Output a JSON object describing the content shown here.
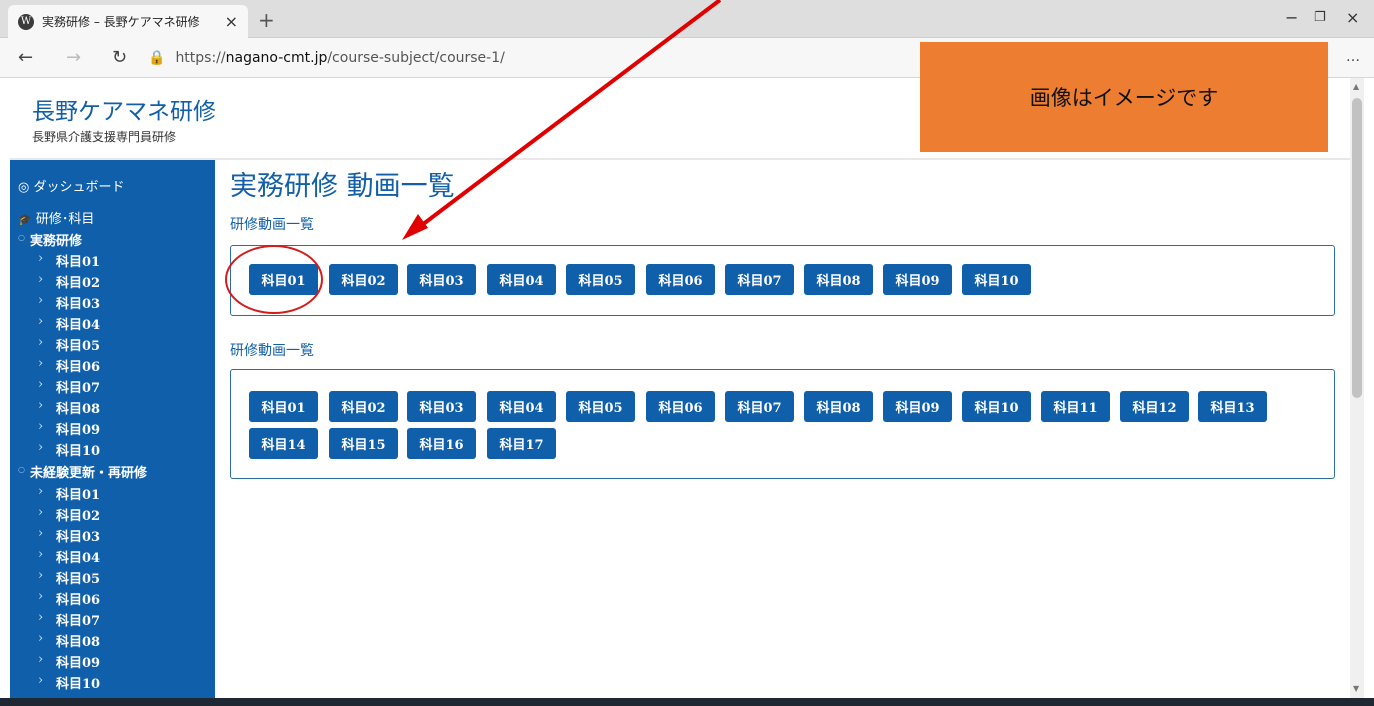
{
  "browser": {
    "tab_title": "実務研修 – 長野ケアマネ研修",
    "tab_favicon": "W",
    "url_prefix": "https://",
    "url_host": "nagano-cmt.jp",
    "url_path": "/course-subject/course-1/",
    "close_tab_glyph": "×",
    "new_tab_glyph": "+",
    "minimize_glyph": "−",
    "restore_glyph": "❐",
    "close_window_glyph": "×",
    "back_glyph": "←",
    "forward_glyph": "→",
    "refresh_glyph": "↻",
    "lock_glyph": "🔒",
    "more_glyph": "…"
  },
  "site": {
    "brand": "長野ケアマネ研修",
    "subtitle": "長野県介護支援専門員研修"
  },
  "sidebar": {
    "dashboard": "ダッシュボード",
    "dashboard_icon": "◎",
    "courses": "研修･科目",
    "courses_icon": "🎓",
    "bullet_glyph": "○",
    "chevron_glyph": "›",
    "group1": {
      "label": "実務研修",
      "items": [
        "科目01",
        "科目02",
        "科目03",
        "科目04",
        "科目05",
        "科目06",
        "科目07",
        "科目08",
        "科目09",
        "科目10"
      ]
    },
    "group2": {
      "label": "未経験更新・再研修",
      "items": [
        "科目01",
        "科目02",
        "科目03",
        "科目04",
        "科目05",
        "科目06",
        "科目07",
        "科目08",
        "科目09",
        "科目10"
      ]
    }
  },
  "main": {
    "page_title": "実務研修 動画一覧",
    "section1": {
      "title": "研修動画一覧",
      "buttons": [
        "科目01",
        "科目02",
        "科目03",
        "科目04",
        "科目05",
        "科目06",
        "科目07",
        "科目08",
        "科目09",
        "科目10"
      ]
    },
    "section2": {
      "title": "研修動画一覧",
      "buttons": [
        "科目01",
        "科目02",
        "科目03",
        "科目04",
        "科目05",
        "科目06",
        "科目07",
        "科目08",
        "科目09",
        "科目10",
        "科目11",
        "科目12",
        "科目13",
        "科目14",
        "科目15",
        "科目16",
        "科目17"
      ]
    }
  },
  "overlay": {
    "note": "画像はイメージです"
  },
  "colors": {
    "primary": "#0f5faa",
    "note_bg": "#ed7d31",
    "annotation": "#d41c1c"
  }
}
